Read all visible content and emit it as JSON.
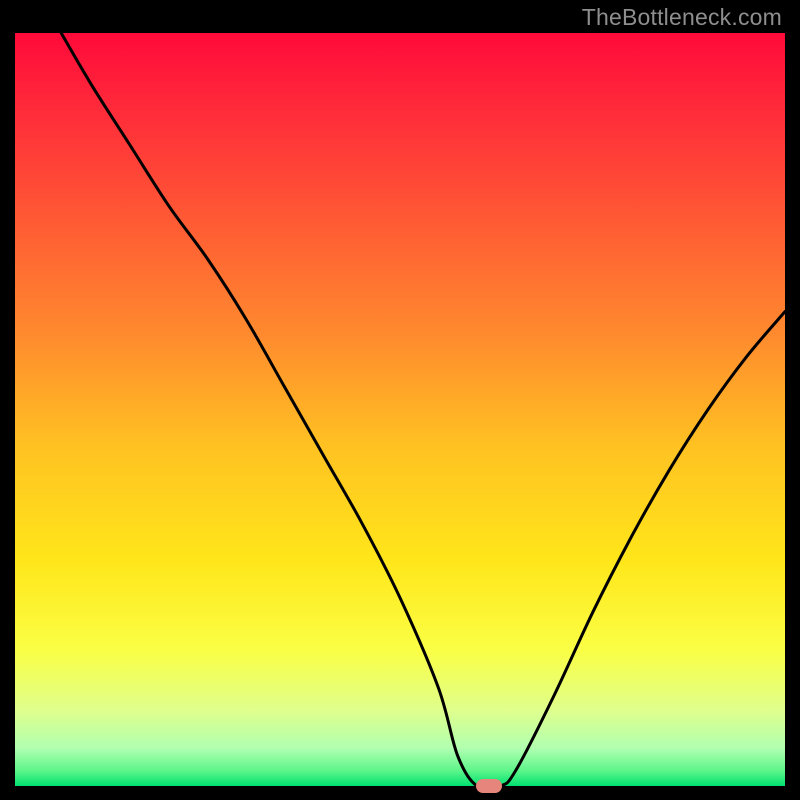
{
  "watermark": "TheBottleneck.com",
  "chart_data": {
    "type": "line",
    "title": "",
    "xlabel": "",
    "ylabel": "",
    "xlim": [
      0,
      100
    ],
    "ylim": [
      0,
      100
    ],
    "grid": false,
    "gradient_stops": [
      {
        "y": 0,
        "color": "#ff0a3a"
      },
      {
        "y": 10,
        "color": "#ff2a3a"
      },
      {
        "y": 25,
        "color": "#ff5a34"
      },
      {
        "y": 40,
        "color": "#ff8a2e"
      },
      {
        "y": 55,
        "color": "#ffc222"
      },
      {
        "y": 70,
        "color": "#ffe61a"
      },
      {
        "y": 82,
        "color": "#faff45"
      },
      {
        "y": 90,
        "color": "#dfff8d"
      },
      {
        "y": 95,
        "color": "#b0ffb0"
      },
      {
        "y": 98,
        "color": "#5cf58a"
      },
      {
        "y": 100,
        "color": "#00e170"
      }
    ],
    "series": [
      {
        "name": "bottleneck-curve",
        "color": "#000000",
        "x": [
          6,
          10,
          15,
          20,
          25,
          30,
          35,
          40,
          45,
          50,
          55,
          57.5,
          60,
          63,
          65,
          70,
          75,
          80,
          85,
          90,
          95,
          100
        ],
        "y": [
          100,
          93,
          85,
          77,
          70,
          62,
          53,
          44,
          35,
          25,
          13,
          4,
          0,
          0,
          2,
          12,
          23,
          33,
          42,
          50,
          57,
          63
        ]
      }
    ],
    "marker": {
      "x": 61.5,
      "y": 0,
      "color": "#e5857c"
    }
  }
}
